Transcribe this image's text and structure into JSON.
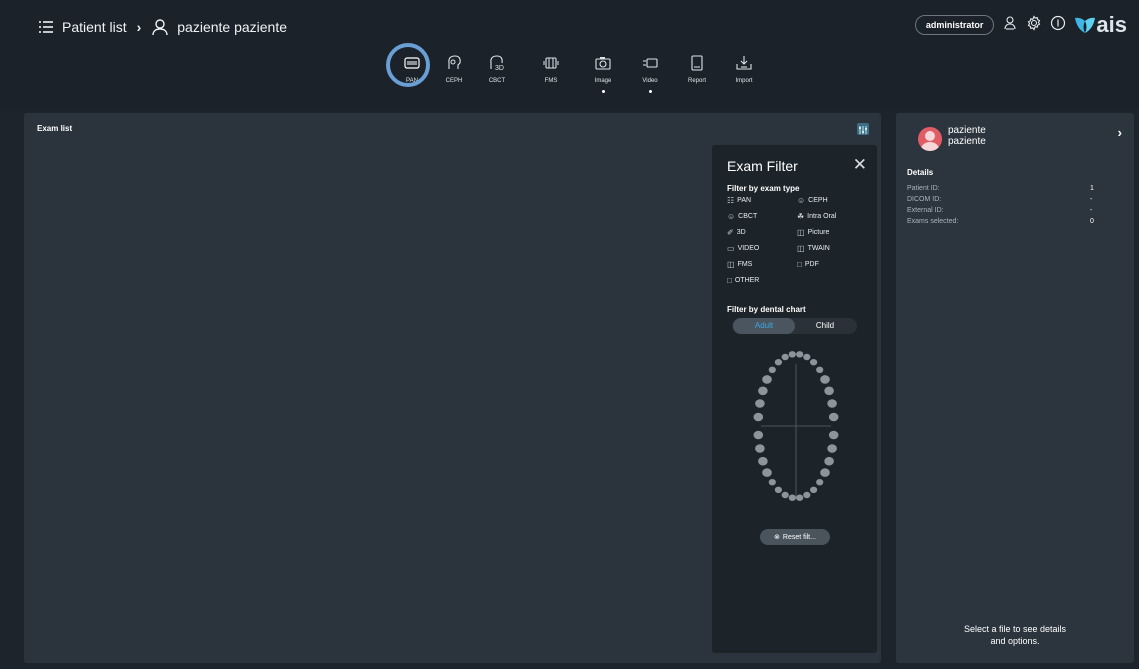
{
  "header": {
    "patient_list_label": "Patient list",
    "patient_name": "paziente paziente",
    "username": "administrator",
    "logo_text": "ais"
  },
  "toolbar": {
    "tools": [
      {
        "label": "PAN",
        "icon": "pan-icon",
        "selected": true,
        "dot": false
      },
      {
        "label": "CEPH",
        "icon": "ceph-icon",
        "dot": false
      },
      {
        "label": "CBCT",
        "icon": "cbct-icon",
        "dot": false
      },
      {
        "label": "FMS",
        "icon": "fms-icon",
        "dot": false
      },
      {
        "label": "Image",
        "icon": "camera-icon",
        "dot": true
      },
      {
        "label": "Video",
        "icon": "video-icon",
        "dot": true
      },
      {
        "label": "Report",
        "icon": "report-icon",
        "dot": false
      },
      {
        "label": "Import",
        "icon": "import-icon",
        "dot": false
      }
    ]
  },
  "exam_list": {
    "title": "Exam list"
  },
  "filter": {
    "title": "Exam Filter",
    "by_type_label": "Filter by exam type",
    "types": [
      {
        "label": "PAN",
        "icon": "pan-icon"
      },
      {
        "label": "CEPH",
        "icon": "ceph-icon"
      },
      {
        "label": "CBCT",
        "icon": "cbct-icon"
      },
      {
        "label": "Intra Oral",
        "icon": "tooth-icon"
      },
      {
        "label": "3D",
        "icon": "scan-icon"
      },
      {
        "label": "Picture",
        "icon": "camera-icon"
      },
      {
        "label": "VIDEO",
        "icon": "video-icon"
      },
      {
        "label": "TWAIN",
        "icon": "scanner-icon"
      },
      {
        "label": "FMS",
        "icon": "fms-icon"
      },
      {
        "label": "PDF",
        "icon": "file-icon"
      },
      {
        "label": "OTHER",
        "icon": "file-icon"
      }
    ],
    "by_chart_label": "Filter by dental chart",
    "chart_tabs": {
      "adult": "Adult",
      "child": "Child",
      "selected": "Adult"
    },
    "reset_label": "Reset filt..."
  },
  "patient_panel": {
    "first_name": "paziente",
    "last_name": "paziente",
    "details_title": "Details",
    "details": [
      {
        "label": "Patient ID:",
        "value": "1"
      },
      {
        "label": "DICOM ID:",
        "value": "-"
      },
      {
        "label": "External ID:",
        "value": "-"
      },
      {
        "label": "Exams selected:",
        "value": "0"
      }
    ],
    "hint_line1": "Select a file to see details",
    "hint_line2": "and options."
  },
  "colors": {
    "accent_ring": "#6a9fd6",
    "avatar": "#e15d66",
    "selected_tab_text": "#3fa6e0",
    "logo_mark": "#3fb6e6"
  }
}
